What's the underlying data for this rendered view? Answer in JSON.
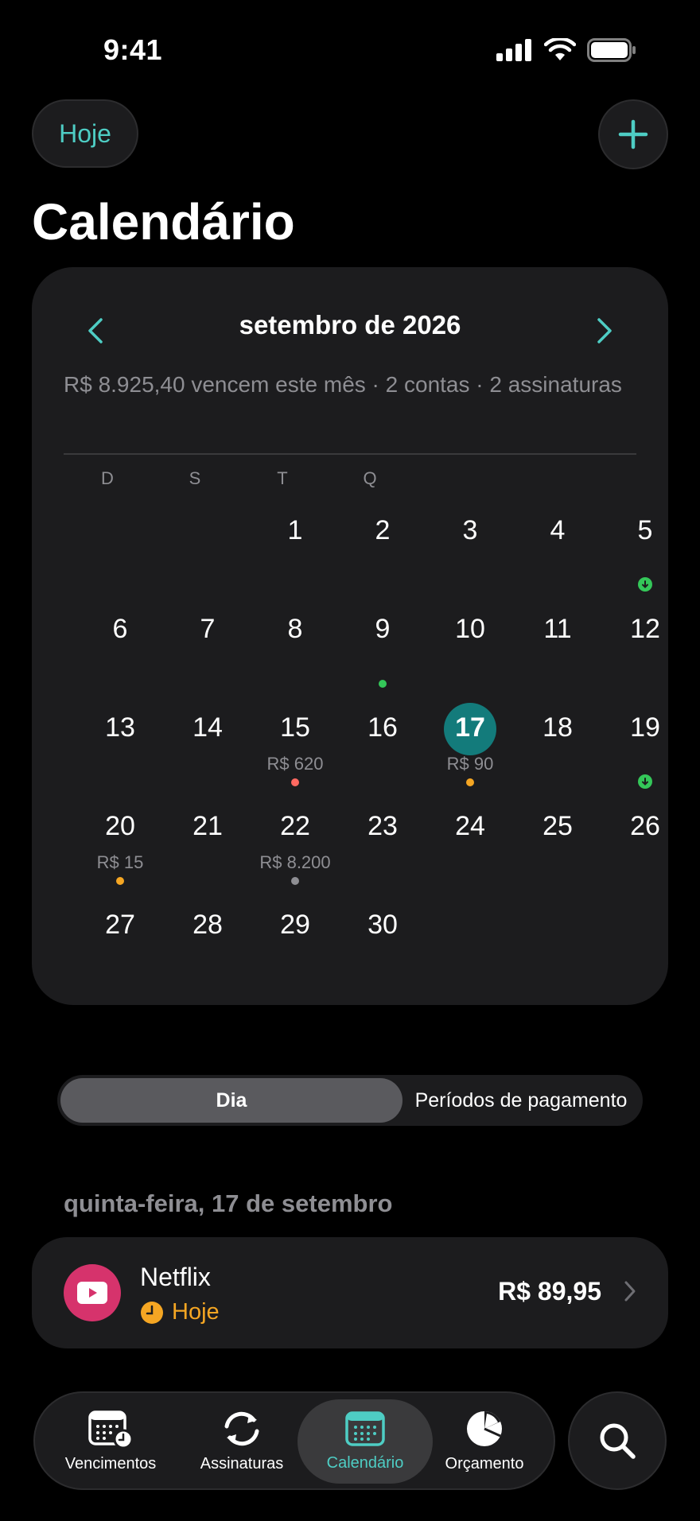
{
  "status_bar": {
    "time": "9:41"
  },
  "header": {
    "today_label": "Hoje",
    "title": "Calendário"
  },
  "calendar": {
    "month_label": "setembro de 2026",
    "summary": "R$ 8.925,40 vencem este mês · 2 contas · 2 assinaturas",
    "weekdays": [
      "D",
      "S",
      "T",
      "Q"
    ],
    "days": [
      {
        "n": "1"
      },
      {
        "n": "2"
      },
      {
        "n": "3"
      },
      {
        "n": "4"
      },
      {
        "n": "5"
      },
      {
        "n": "6"
      },
      {
        "n": "7"
      },
      {
        "n": "8"
      },
      {
        "n": "9"
      },
      {
        "n": "10"
      },
      {
        "n": "11"
      },
      {
        "n": "12"
      },
      {
        "n": "13"
      },
      {
        "n": "14"
      },
      {
        "n": "15",
        "amount": "R$ 620"
      },
      {
        "n": "16"
      },
      {
        "n": "17",
        "amount": "R$ 90"
      },
      {
        "n": "18"
      },
      {
        "n": "19"
      },
      {
        "n": "20",
        "amount": "R$ 15"
      },
      {
        "n": "21"
      },
      {
        "n": "22",
        "amount": "R$ 8.200"
      },
      {
        "n": "23"
      },
      {
        "n": "24"
      },
      {
        "n": "25"
      },
      {
        "n": "26"
      },
      {
        "n": "27"
      },
      {
        "n": "28"
      },
      {
        "n": "29"
      },
      {
        "n": "30"
      }
    ],
    "colors": {
      "accent": "#4ecdc4",
      "today": "#137b7b",
      "red": "#ff6961",
      "orange": "#f5a623",
      "gray": "#8e8e93",
      "green": "#34c759"
    }
  },
  "segmented": {
    "option_1": "Dia",
    "option_2": "Períodos de pagamento"
  },
  "selected_day": {
    "label": "quinta-feira, 17 de setembro",
    "bill": {
      "name": "Netflix",
      "status": "Hoje",
      "amount": "R$ 89,95",
      "icon": "play-icon"
    }
  },
  "tabs": [
    {
      "label": "Vencimentos",
      "icon": "calendar-clock-icon"
    },
    {
      "label": "Assinaturas",
      "icon": "refresh-icon"
    },
    {
      "label": "Calendário",
      "icon": "calendar-icon"
    },
    {
      "label": "Orçamento",
      "icon": "pie-chart-icon"
    }
  ]
}
